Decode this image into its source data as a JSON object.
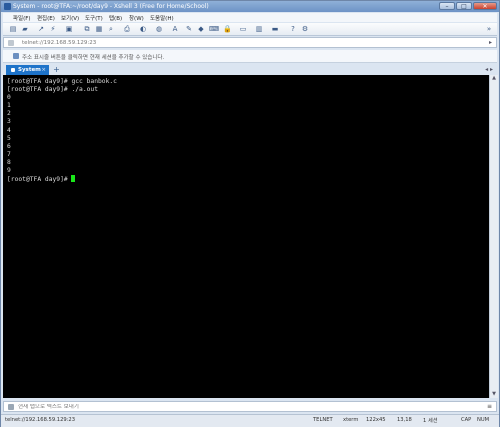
{
  "window": {
    "title": "System - root@TFA:~/root/day9 - Xshell 3 (Free for Home/School)",
    "controls": [
      "–",
      "□",
      "✕"
    ]
  },
  "menu": [
    "파일(F)",
    "편집(E)",
    "보기(V)",
    "도구(T)",
    "탭(B)",
    "창(W)",
    "도움말(H)"
  ],
  "address": {
    "value": "telnet://192.168.59.129:23"
  },
  "infobar": {
    "text": "주소 표시줄 버튼을 클릭하면 현재 세션을 추가할 수 있습니다."
  },
  "tabs": [
    {
      "label": "System"
    }
  ],
  "terminal": {
    "lines": [
      "[root@TFA day9]# gcc banbok.c",
      "[root@TFA day9]# ./a.out",
      "0",
      "1",
      "2",
      "3",
      "4",
      "5",
      "6",
      "7",
      "8",
      "9"
    ],
    "prompt": "[root@TFA day9]# "
  },
  "sendbar": {
    "placeholder": "현재 탭으로 텍스트 보내기"
  },
  "status": {
    "connection": "telnet://192.168.59.129:23",
    "protocol": "TELNET",
    "term": "xterm",
    "size": "122x45",
    "cursor_pos": "13,18",
    "sessions": "1 세션",
    "cap": "CAP",
    "num": "NUM"
  },
  "colors": {
    "accent": "#1e73c9",
    "cursor": "#19e619",
    "terminal_bg": "#000000"
  }
}
